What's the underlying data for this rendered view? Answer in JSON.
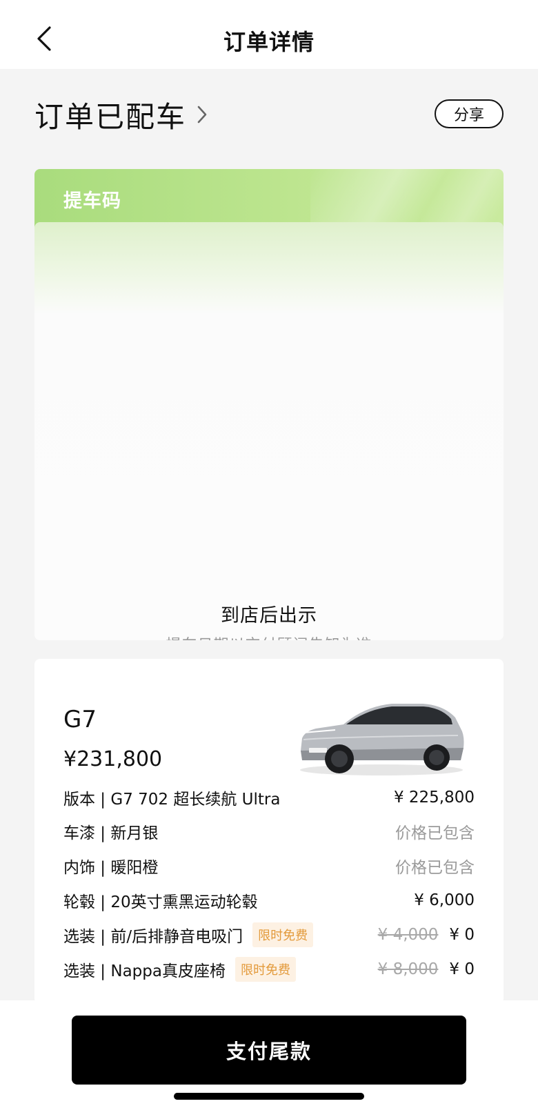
{
  "nav": {
    "title": "订单详情"
  },
  "status": {
    "title": "订单已配车",
    "share_label": "分享"
  },
  "pickup": {
    "label": "提车码",
    "show_text": "到店后出示",
    "note": "提车日期以交付顾问告知为准"
  },
  "car": {
    "model": "G7",
    "price": "¥231,800",
    "specs": [
      {
        "label": "版本 | G7 702 超长续航 Ultra",
        "price": "¥ 225,800"
      },
      {
        "label": "车漆 | 新月银",
        "price": "价格已包含"
      },
      {
        "label": "内饰 | 暖阳橙",
        "price": "价格已包含"
      },
      {
        "label": "轮毂 | 20英寸熏黑运动轮毂",
        "price": "¥ 6,000"
      },
      {
        "label": "选装 | 前/后排静音电吸门",
        "tag": "限时免费",
        "original_price": "¥ 4,000",
        "price": "¥ 0"
      },
      {
        "label": "选装 | Nappa真皮座椅",
        "tag": "限时免费",
        "original_price": "¥ 8,000",
        "price": "¥ 0"
      }
    ]
  },
  "footer": {
    "pay_label": "支付尾款"
  }
}
